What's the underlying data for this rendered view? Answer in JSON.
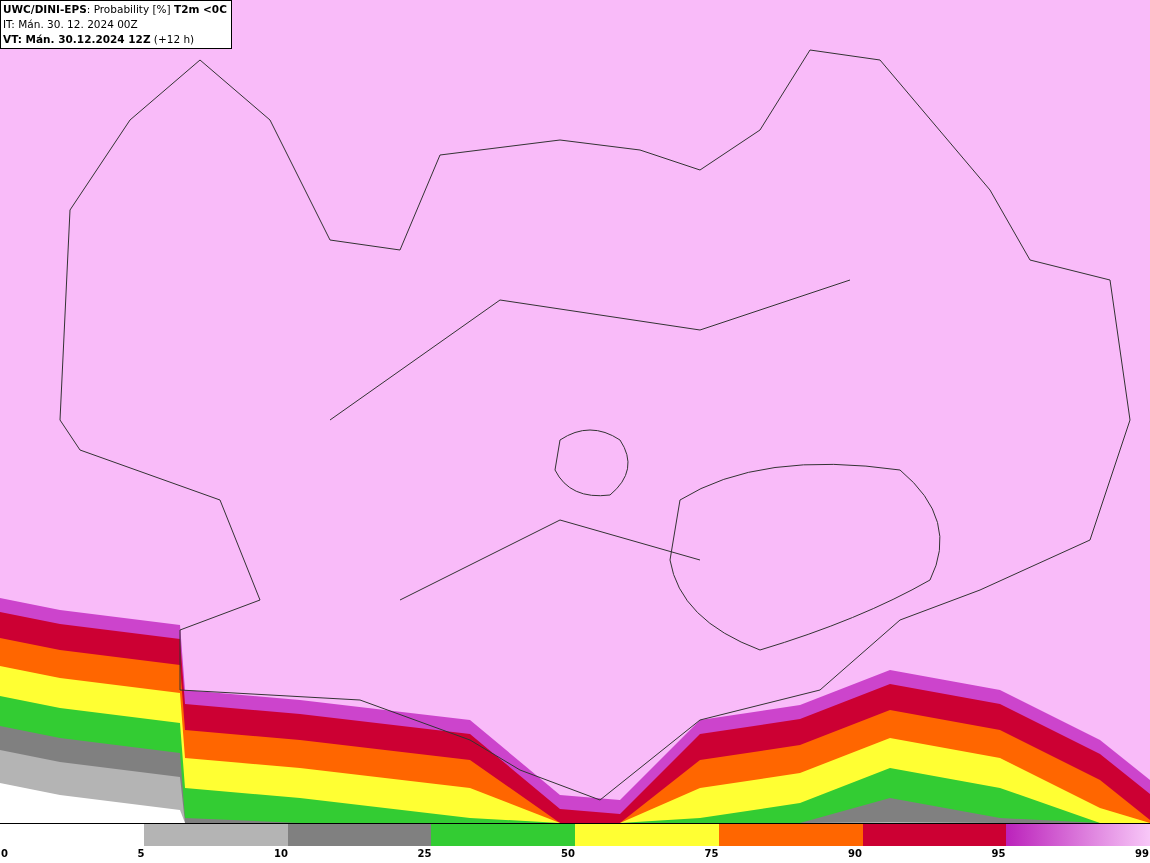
{
  "header": {
    "title": "**UWC/DINI-EPS**: Probability [%] **T2m <0C**",
    "init_time": "IT: Mán. 30. 12. 2024 00Z",
    "valid_time": "**VT: Mán. 30.12.2024 12Z** (+12 h)"
  },
  "legend": {
    "segments": [
      {
        "kind": "blank"
      },
      {
        "kind": "solid",
        "color": "#b4b4b4"
      },
      {
        "kind": "solid",
        "color": "#808080"
      },
      {
        "kind": "solid",
        "color": "#33cc33"
      },
      {
        "kind": "solid",
        "color": "#ffff33"
      },
      {
        "kind": "solid",
        "color": "#ff6600"
      },
      {
        "kind": "solid",
        "color": "#cc0033"
      },
      {
        "kind": "gradient"
      }
    ],
    "labels": [
      "0",
      "5",
      "10",
      "25",
      "50",
      "75",
      "90",
      "95",
      "99"
    ]
  }
}
